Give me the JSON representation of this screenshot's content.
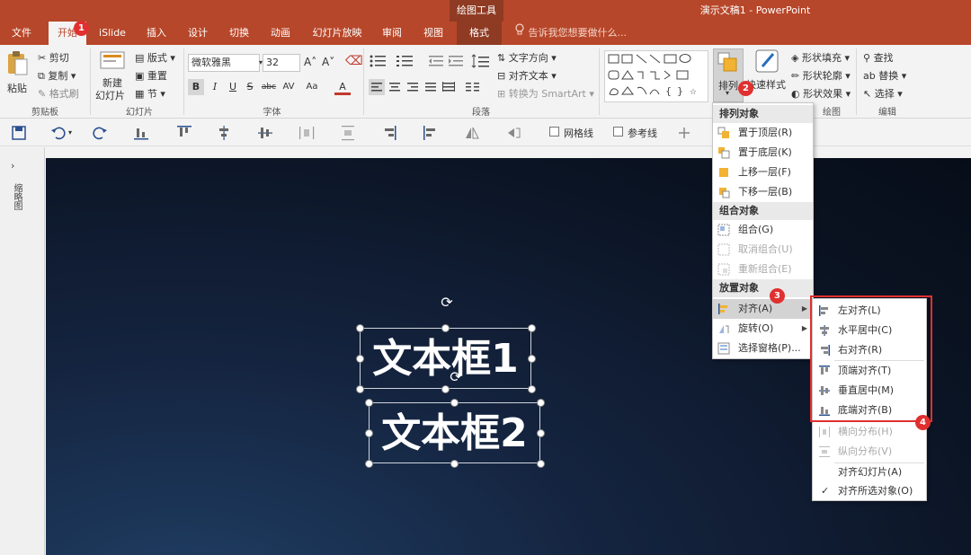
{
  "titlebar": {
    "context_tool": "绘图工具",
    "doc_title": "演示文稿1 - PowerPoint"
  },
  "tabs": [
    "文件",
    "开始",
    "iSlide",
    "插入",
    "设计",
    "切换",
    "动画",
    "幻灯片放映",
    "审阅",
    "视图",
    "格式"
  ],
  "tell_me": "告诉我您想要做什么...",
  "ribbon": {
    "clipboard": {
      "paste": "粘贴",
      "cut": "剪切",
      "copy": "复制",
      "format_painter": "格式刷",
      "label": "剪贴板"
    },
    "slides": {
      "new_slide_1": "新建",
      "new_slide_2": "幻灯片",
      "layout": "版式",
      "reset": "重置",
      "section": "节",
      "label": "幻灯片"
    },
    "font": {
      "name": "微软雅黑",
      "size": "32",
      "label": "字体",
      "bold": "B",
      "italic": "I",
      "underline": "U",
      "strike": "S",
      "shadow": "abc",
      "spacing": "AV",
      "case": "Aa",
      "color": "A",
      "grow": "A˄",
      "shrink": "A˅"
    },
    "paragraph": {
      "text_direction": "文字方向",
      "align_text": "对齐文本",
      "smartart": "转换为 SmartArt",
      "label": "段落"
    },
    "drawing": {
      "arrange": "排列",
      "quick_styles": "快速样式",
      "shape_fill": "形状填充",
      "shape_outline": "形状轮廓",
      "shape_effects": "形状效果",
      "label": "绘图"
    },
    "editing": {
      "find": "查找",
      "replace": "替换",
      "select": "选择",
      "label": "编辑"
    }
  },
  "qat": {
    "gridlines": "网格线",
    "guides": "参考线"
  },
  "side_panel": {
    "label": "缩略图"
  },
  "slide": {
    "textbox1": "文本框1",
    "textbox2": "文本框2"
  },
  "arrange_menu": {
    "h_order": "排列对象",
    "bring_front": "置于顶层(R)",
    "send_back": "置于底层(K)",
    "forward": "上移一层(F)",
    "backward": "下移一层(B)",
    "h_group": "组合对象",
    "group": "组合(G)",
    "ungroup": "取消组合(U)",
    "regroup": "重新组合(E)",
    "h_position": "放置对象",
    "align": "对齐(A)",
    "rotate": "旋转(O)",
    "selection_pane": "选择窗格(P)..."
  },
  "align_menu": {
    "left": "左对齐(L)",
    "center": "水平居中(C)",
    "right": "右对齐(R)",
    "top": "顶端对齐(T)",
    "middle": "垂直居中(M)",
    "bottom": "底端对齐(B)",
    "dist_h": "横向分布(H)",
    "dist_v": "纵向分布(V)",
    "to_slide": "对齐幻灯片(A)",
    "to_selected": "对齐所选对象(O)",
    "check": "✓"
  },
  "badges": [
    "1",
    "2",
    "3",
    "4"
  ],
  "colors": {
    "accent": "#b7472a",
    "highlight_red": "#e0302f"
  }
}
